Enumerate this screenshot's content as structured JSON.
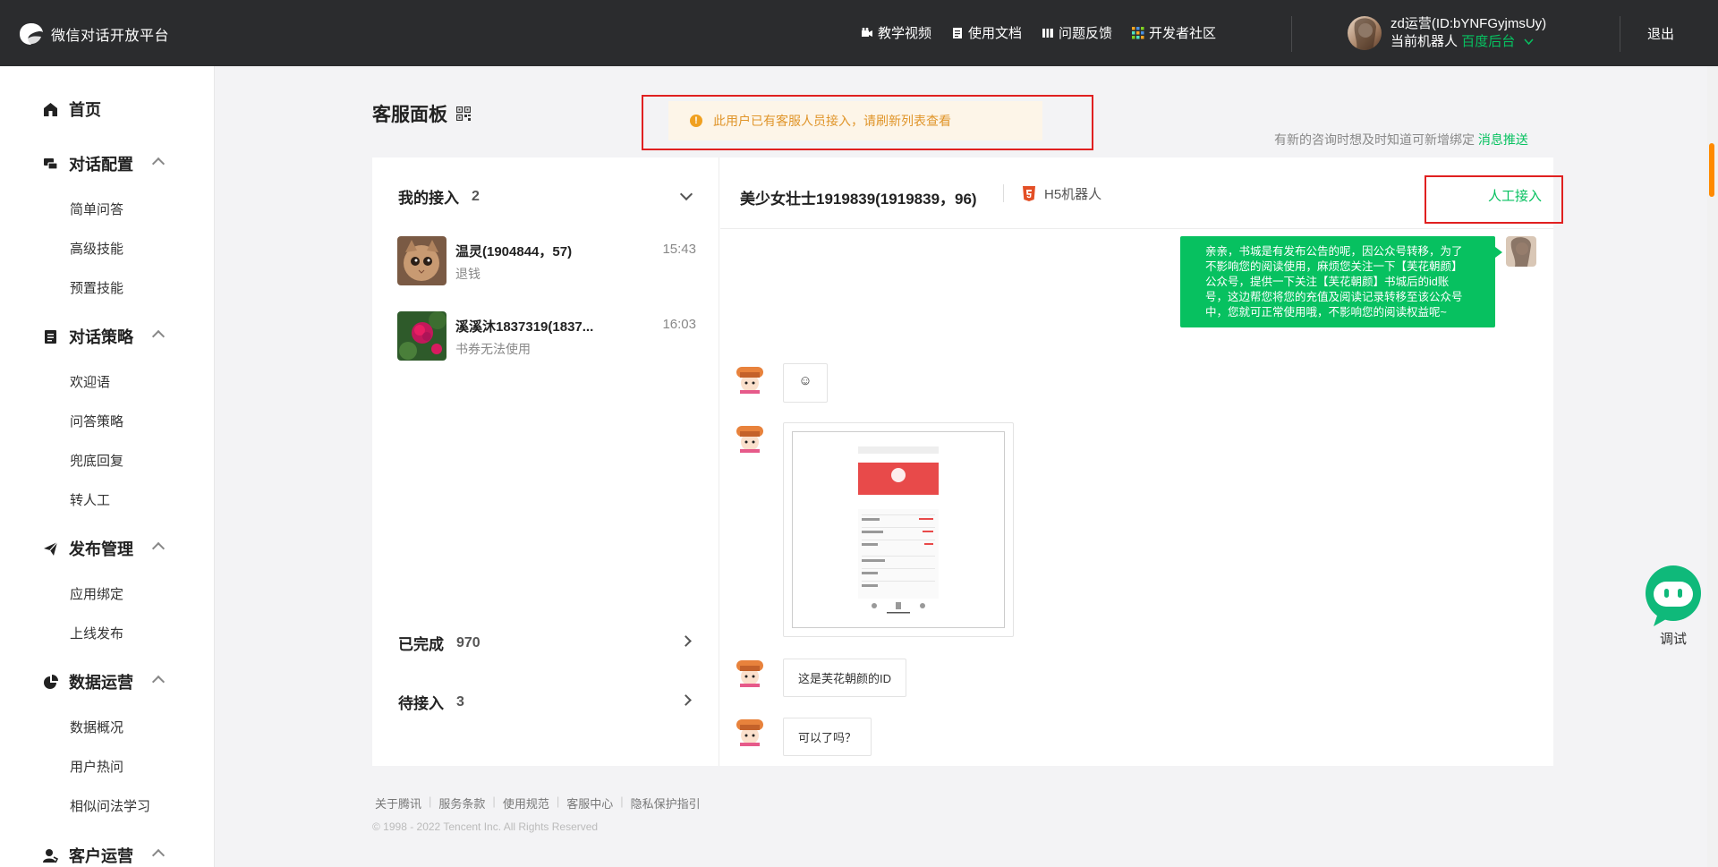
{
  "app": {
    "title": "微信对话开放平台"
  },
  "topnav": [
    {
      "label": "教学视频",
      "icon": "video-icon"
    },
    {
      "label": "使用文档",
      "icon": "document-icon"
    },
    {
      "label": "问题反馈",
      "icon": "feedback-icon"
    },
    {
      "label": "开发者社区",
      "icon": "community-icon"
    }
  ],
  "user": {
    "name": "zd运营(ID:bYNFGyjmsUy)",
    "robot_label": "当前机器人",
    "robot_name": "百度后台",
    "logout": "退出"
  },
  "sidebar": {
    "home": "首页",
    "groups": [
      {
        "label": "对话配置",
        "icon": "chat-config-icon",
        "items": [
          "简单问答",
          "高级技能",
          "预置技能"
        ]
      },
      {
        "label": "对话策略",
        "icon": "strategy-icon",
        "items": [
          "欢迎语",
          "问答策略",
          "兜底回复",
          "转人工"
        ]
      },
      {
        "label": "发布管理",
        "icon": "publish-icon",
        "items": [
          "应用绑定",
          "上线发布"
        ]
      },
      {
        "label": "数据运营",
        "icon": "data-icon",
        "items": [
          "数据概况",
          "用户热问",
          "相似问法学习"
        ]
      },
      {
        "label": "客户运营",
        "icon": "customer-icon",
        "items": []
      }
    ]
  },
  "page": {
    "title": "客服面板",
    "alert": "此用户已有客服人员接入，请刷新列表查看",
    "hint_text": "有新的咨询时想及时知道可新增绑定",
    "hint_link": "消息推送"
  },
  "my_sessions": {
    "label": "我的接入",
    "count": "2",
    "items": [
      {
        "name": "温灵(1904844，57)",
        "preview": "退钱",
        "time": "15:43"
      },
      {
        "name": "溪溪沐1837319(1837...",
        "preview": "书券无法使用",
        "time": "16:03"
      }
    ]
  },
  "completed": {
    "label": "已完成",
    "count": "970"
  },
  "pending": {
    "label": "待接入",
    "count": "3"
  },
  "chat": {
    "title": "美少女壮士1919839(1919839，96)",
    "source": "H5机器人",
    "takeover": "人工接入",
    "outgoing": "亲亲，书城是有发布公告的呢，因公众号转移，为了不影响您的阅读使用，麻烦您关注一下【芙花朝颜】公众号，提供一下关注【芙花朝颜】书城后的id账号，这边帮您将您的充值及阅读记录转移至该公众号中，您就可正常使用哦，不影响您的阅读权益呢~",
    "msg_emoji": "☺",
    "msg_text1": "这是芙花朝颜的ID",
    "msg_text2": "可以了吗？"
  },
  "footer": {
    "links": [
      "关于腾讯",
      "服务条款",
      "使用规范",
      "客服中心",
      "隐私保护指引"
    ],
    "copyright": "© 1998 - 2022 Tencent Inc. All Rights Reserved"
  },
  "debug": {
    "label": "调试"
  }
}
